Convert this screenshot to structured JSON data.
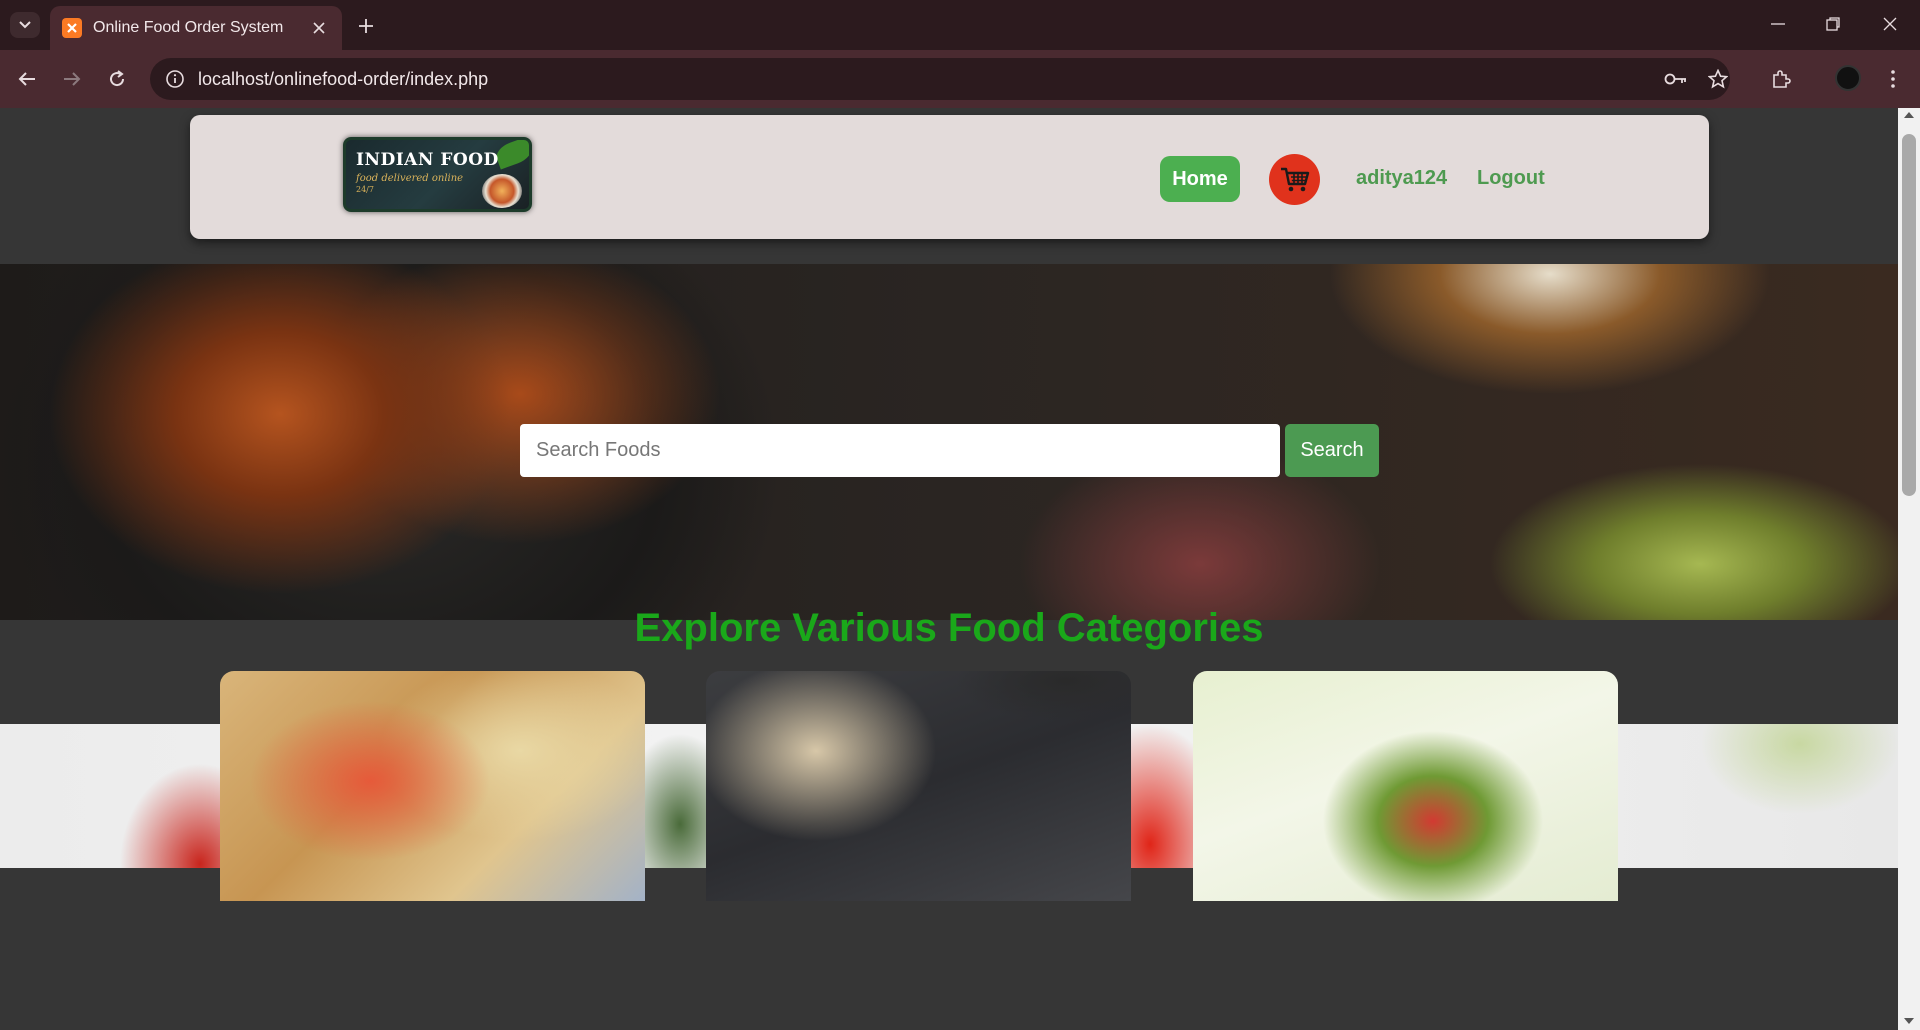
{
  "browser": {
    "tab_title": "Online Food Order System",
    "url": "localhost/onlinefood-order/index.php",
    "icons": {
      "tab_search": "chevron-down-icon",
      "favicon": "xampp-favicon-icon",
      "close_tab": "close-icon",
      "new_tab": "plus-icon",
      "back": "arrow-left-icon",
      "forward": "arrow-right-icon",
      "reload": "reload-icon",
      "site_info": "info-icon",
      "password": "key-icon",
      "bookmark": "star-icon",
      "extensions": "puzzle-icon",
      "profile": "profile-avatar",
      "menu": "kebab-menu-icon",
      "minimize": "minimize-icon",
      "restore": "restore-icon",
      "close_window": "close-icon"
    }
  },
  "navbar": {
    "logo_title": "INDIAN FOOD",
    "logo_tagline": "food delivered online",
    "logo_tagline2": "24/7",
    "home_label": "Home",
    "cart_icon": "shopping-cart-icon",
    "username": "aditya124",
    "logout_label": "Logout"
  },
  "hero": {
    "search_placeholder": "Search Foods",
    "search_value": "",
    "search_button": "Search"
  },
  "categories": {
    "heading": "Explore Various Food Categories",
    "cards": [
      {
        "image": "sandwich-photo"
      },
      {
        "image": "pasta-photo"
      },
      {
        "image": "wrap-photo"
      }
    ]
  },
  "colors": {
    "accent_green": "#4caf50",
    "heading_green": "#1aa81a",
    "cart_red": "#e0321c",
    "page_bg": "#363636"
  }
}
